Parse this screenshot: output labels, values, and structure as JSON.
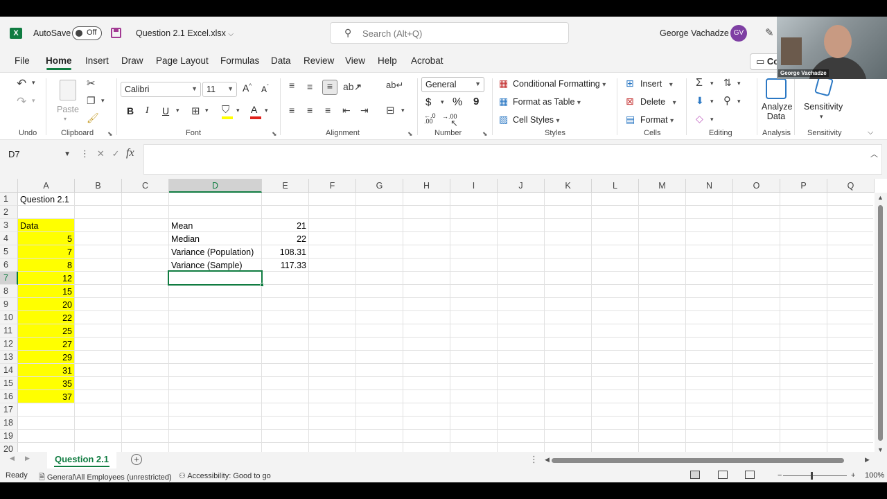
{
  "titlebar": {
    "app_icon": "excel-icon",
    "autosave_label": "AutoSave",
    "autosave_state": "Off",
    "document_name": "Question 2.1 Excel.xlsx",
    "search_placeholder": "Search (Alt+Q)",
    "user_name": "George Vachadze",
    "user_initials": "GV"
  },
  "menu": {
    "tabs": [
      "File",
      "Home",
      "Insert",
      "Draw",
      "Page Layout",
      "Formulas",
      "Data",
      "Review",
      "View",
      "Help",
      "Acrobat"
    ],
    "active": "Home",
    "comments_label": "Co"
  },
  "ribbon": {
    "groups": {
      "undo": "Undo",
      "clipboard": "Clipboard",
      "font": "Font",
      "alignment": "Alignment",
      "number": "Number",
      "styles": "Styles",
      "cells": "Cells",
      "editing": "Editing",
      "analysis": "Analysis",
      "sensitivity": "Sensitivity"
    },
    "paste_label": "Paste",
    "font_name": "Calibri",
    "font_size": "11",
    "number_format": "General",
    "conditional_formatting": "Conditional Formatting",
    "format_as_table": "Format as Table",
    "cell_styles": "Cell Styles",
    "insert": "Insert",
    "delete": "Delete",
    "format": "Format",
    "analyze_data_line1": "Analyze",
    "analyze_data_line2": "Data",
    "sensitivity_btn": "Sensitivity",
    "currency_symbol": "$",
    "percent_symbol": "%",
    "comma_symbol": "9",
    "font_grow": "A",
    "font_shrink": "A",
    "bold": "B",
    "italic": "I",
    "underline": "U",
    "font_color": "A",
    "decimal_left_top": "←.0",
    "decimal_left_bottom": ".00",
    "decimal_right": ".00"
  },
  "formula_bar": {
    "name_box": "D7",
    "fx": "fx",
    "formula": ""
  },
  "grid": {
    "columns": [
      "A",
      "B",
      "C",
      "D",
      "E",
      "F",
      "G",
      "H",
      "I",
      "J",
      "K",
      "L",
      "M",
      "N",
      "O",
      "P",
      "Q"
    ],
    "rows": [
      "1",
      "2",
      "3",
      "4",
      "5",
      "6",
      "7",
      "8",
      "9",
      "10",
      "11",
      "12",
      "13",
      "14",
      "15",
      "16",
      "17",
      "18",
      "19",
      "20"
    ],
    "selected_col": "D",
    "selected_row": "7",
    "title_cell": "Question 2.1",
    "data_header": "Data",
    "data_values": [
      "5",
      "7",
      "8",
      "12",
      "15",
      "20",
      "22",
      "25",
      "27",
      "29",
      "31",
      "35",
      "37"
    ],
    "stats": [
      {
        "label": "Mean",
        "value": "21"
      },
      {
        "label": "Median",
        "value": "22"
      },
      {
        "label": "Variance (Population)",
        "value": "108.31"
      },
      {
        "label": "Variance (Sample)",
        "value": "117.33"
      }
    ],
    "highlight_color": "#ffff00",
    "selection_color": "#107c41"
  },
  "sheets": {
    "active": "Question 2.1",
    "add": "+"
  },
  "status": {
    "ready": "Ready",
    "sensitivity": "General\\All Employees (unrestricted)",
    "accessibility": "Accessibility: Good to go",
    "zoom": "100%"
  },
  "webcam": {
    "name": "George Vachadze"
  },
  "colors": {
    "accent": "#107c41",
    "avatar": "#7e3fa3"
  }
}
